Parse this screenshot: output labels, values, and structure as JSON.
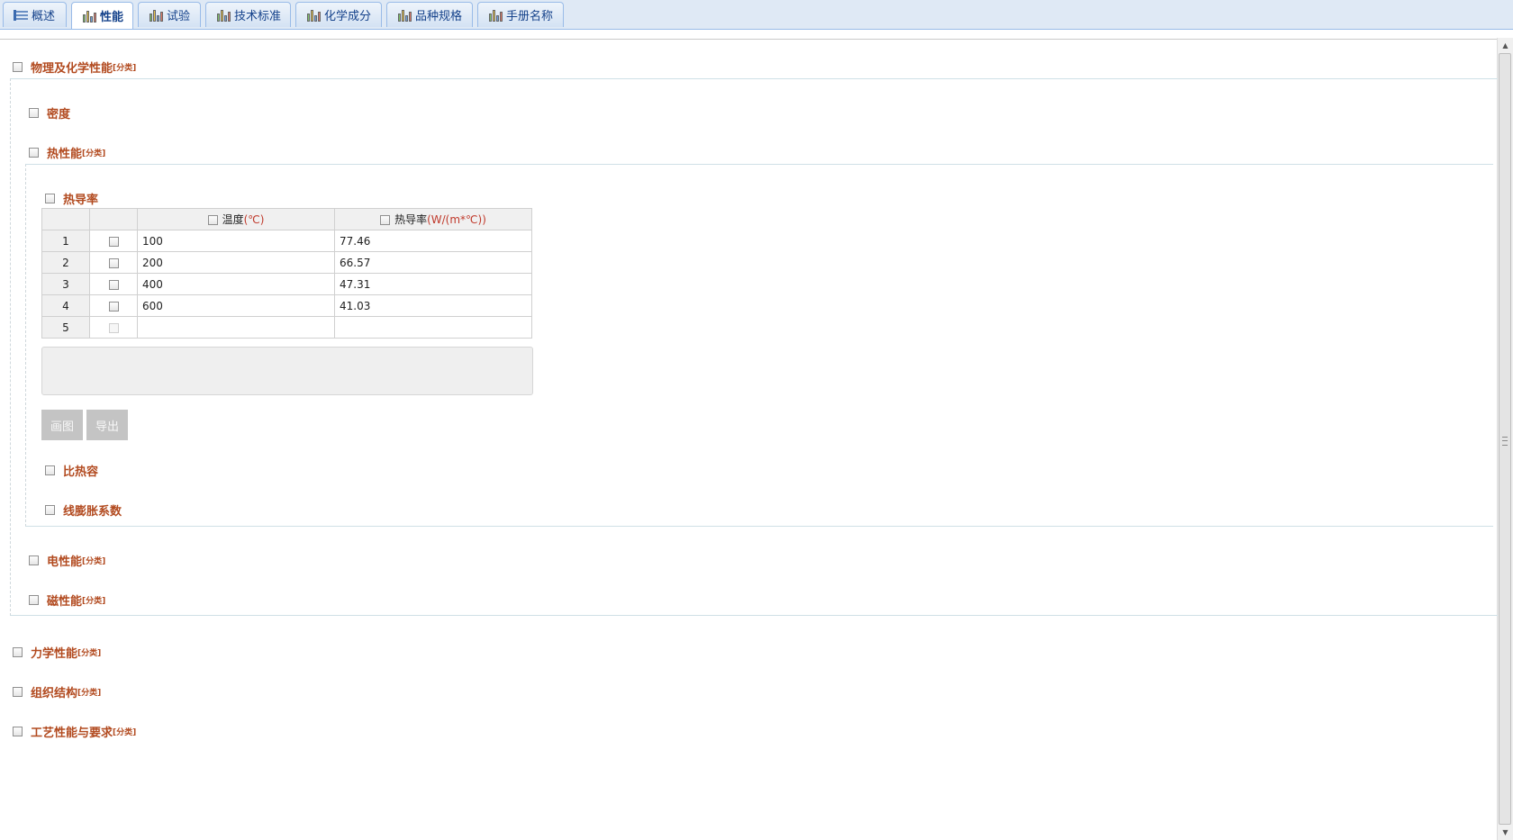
{
  "tabs": [
    {
      "label": "概述",
      "icon": "list-icon",
      "active": false
    },
    {
      "label": "性能",
      "icon": "bar-chart-icon",
      "active": true
    },
    {
      "label": "试验",
      "icon": "bar-chart-icon",
      "active": false
    },
    {
      "label": "技术标准",
      "icon": "bar-chart-icon",
      "active": false
    },
    {
      "label": "化学成分",
      "icon": "bar-chart-icon",
      "active": false
    },
    {
      "label": "品种规格",
      "icon": "bar-chart-icon",
      "active": false
    },
    {
      "label": "手册名称",
      "icon": "bar-chart-icon",
      "active": false
    }
  ],
  "category_tag": "[分类]",
  "tree": {
    "physchem": "物理及化学性能",
    "density": "密度",
    "thermal": "热性能",
    "thermal_conductivity": "热导率",
    "specific_heat": "比热容",
    "linear_expansion": "线膨胀系数",
    "electrical": "电性能",
    "magnetic": "磁性能",
    "mechanical": "力学性能",
    "microstructure": "组织结构",
    "process": "工艺性能与要求"
  },
  "table": {
    "col_temp": "温度",
    "col_temp_unit": "(℃)",
    "col_cond": "热导率",
    "col_cond_unit": "(W/(m*℃))",
    "rows": [
      {
        "no": "1",
        "temp": "100",
        "cond": "77.46"
      },
      {
        "no": "2",
        "temp": "200",
        "cond": "66.57"
      },
      {
        "no": "3",
        "temp": "400",
        "cond": "47.31"
      },
      {
        "no": "4",
        "temp": "600",
        "cond": "41.03"
      },
      {
        "no": "5",
        "temp": "",
        "cond": ""
      }
    ]
  },
  "buttons": {
    "plot": "画图",
    "export": "导出"
  },
  "colors": {
    "label": "#b24a1f",
    "tab_border": "#99bbe8",
    "button": "#c4c4c4"
  }
}
